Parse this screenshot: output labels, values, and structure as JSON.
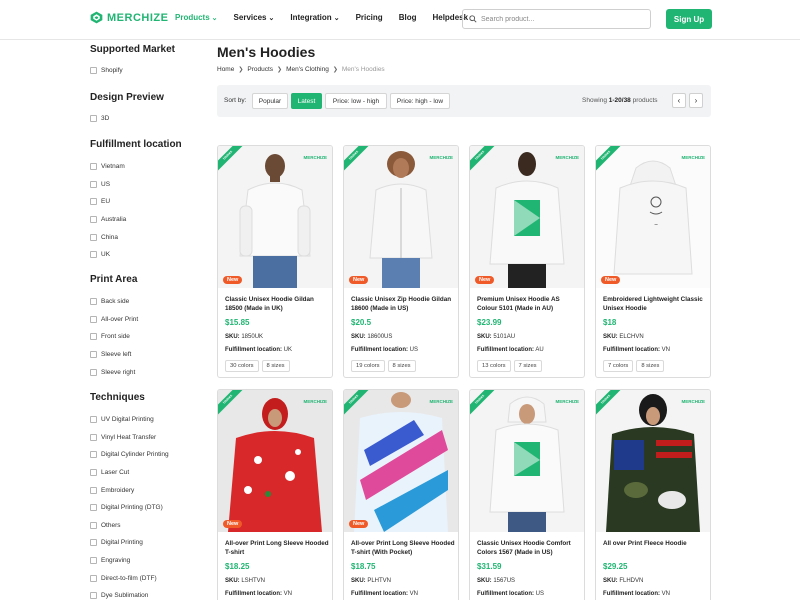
{
  "header": {
    "logo": "MERCHIZE",
    "nav": [
      {
        "label": "Products",
        "has_caret": true
      },
      {
        "label": "Services",
        "has_caret": true
      },
      {
        "label": "Integration",
        "has_caret": true
      },
      {
        "label": "Pricing",
        "has_caret": false
      },
      {
        "label": "Blog",
        "has_caret": false
      },
      {
        "label": "Helpdesk",
        "has_caret": false
      }
    ],
    "search_placeholder": "Search product...",
    "signup_label": "Sign Up"
  },
  "sidebar": {
    "groups": [
      {
        "title": "Supported Market",
        "options": [
          "Shopify"
        ]
      },
      {
        "title": "Design Preview",
        "options": [
          "3D"
        ]
      },
      {
        "title": "Fulfillment location",
        "options": [
          "Vietnam",
          "US",
          "EU",
          "Australia",
          "China",
          "UK"
        ]
      },
      {
        "title": "Print Area",
        "options": [
          "Back side",
          "All-over Print",
          "Front side",
          "Sleeve left",
          "Sleeve right"
        ]
      },
      {
        "title": "Techniques",
        "options": [
          "UV Digital Printing",
          "Vinyl Heat Transfer",
          "Digital Cylinder Printing",
          "Laser Cut",
          "Embroidery",
          "Digital Printing (DTG)",
          "Others",
          "Digital Printing",
          "Engraving",
          "Direct-to-film (DTF)",
          "Dye Sublimation"
        ]
      }
    ]
  },
  "main": {
    "title": "Men's Hoodies",
    "breadcrumb": [
      "Home",
      "Products",
      "Men's Clothing",
      "Men's Hoodies"
    ],
    "sort": {
      "label": "Sort by:",
      "options": [
        "Popular",
        "Latest",
        "Price: low - high",
        "Price: high - low"
      ],
      "active": "Latest"
    },
    "showing_prefix": "Showing",
    "showing_range": "1-20/38",
    "showing_suffix": "products",
    "pager_prev": "‹",
    "pager_next": "›"
  },
  "products": [
    {
      "title": "Classic Unisex Hoodie Gildan 18500 (Made in UK)",
      "price": "$15.85",
      "sku": "1850UK",
      "location": "UK",
      "colors": "30 colors",
      "sizes": "8 sizes",
      "ribbon": "Unisex",
      "brand": "MERCHIZE",
      "badge": "New",
      "image": "white-hoodie-man"
    },
    {
      "title": "Classic Unisex Zip Hoodie Gildan 18600 (Made in US)",
      "price": "$20.5",
      "sku": "18600US",
      "location": "US",
      "colors": "19 colors",
      "sizes": "8 sizes",
      "ribbon": "Unisex",
      "brand": "MERCHIZE",
      "badge": "New",
      "image": "white-zip-hoodie-woman"
    },
    {
      "title": "Premium Unisex Hoodie AS Colour 5101 (Made in AU)",
      "price": "$23.99",
      "sku": "5101AU",
      "location": "AU",
      "colors": "13 colors",
      "sizes": "7 sizes",
      "ribbon": "Unisex",
      "brand": "MERCHIZE",
      "badge": "New",
      "image": "white-hoodie-print-woman"
    },
    {
      "title": "Embroidered Lightweight Classic Unisex Hoodie",
      "price": "$18",
      "sku": "ELCHVN",
      "location": "VN",
      "colors": "7 colors",
      "sizes": "8 sizes",
      "ribbon": "Unisex",
      "brand": "MERCHIZE",
      "badge": "New",
      "image": "embroidered-hoodie"
    },
    {
      "title": "All-over Print Long Sleeve Hooded T-shirt",
      "price": "$18.25",
      "sku": "LSHTVN",
      "location": "VN",
      "ribbon": "Unisex",
      "brand": "MERCHIZE",
      "badge": "New",
      "image": "red-aop-hoodie"
    },
    {
      "title": "All-over Print Long Sleeve Hooded T-shirt (With Pocket)",
      "price": "$18.75",
      "sku": "PLHTVN",
      "location": "VN",
      "ribbon": "Unisex",
      "brand": "MERCHIZE",
      "badge": "New",
      "image": "blue-pink-aop-hoodie"
    },
    {
      "title": "Classic Unisex Hoodie Comfort Colors 1567 (Made in US)",
      "price": "$31.59",
      "sku": "1567US",
      "location": "US",
      "ribbon": "Unisex",
      "brand": "MERCHIZE",
      "badge": "",
      "image": "white-hoodie-print-man"
    },
    {
      "title": "All over Print Fleece Hoodie",
      "price": "$29.25",
      "sku": "FLHDVN",
      "location": "VN",
      "ribbon": "Unisex",
      "brand": "MERCHIZE",
      "badge": "",
      "image": "camo-flag-aop-hoodie"
    }
  ],
  "labels": {
    "sku": "SKU:",
    "location": "Fulfillment location:"
  },
  "colors": {
    "accent": "#21b573",
    "badge": "#f05a28"
  }
}
